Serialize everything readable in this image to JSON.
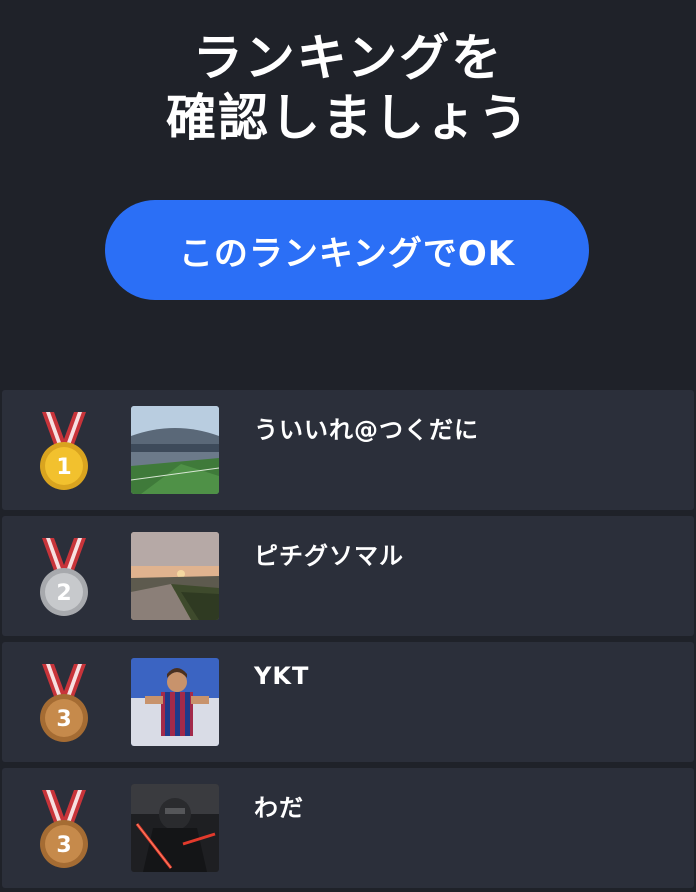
{
  "header": {
    "title_line1": "ランキングを",
    "title_line2": "確認しましょう"
  },
  "confirm_button_label": "このランキングでOK",
  "colors": {
    "background": "#1f2229",
    "row_background": "#2b2f3a",
    "button": "#2b6ff6",
    "gold": "#f2c12e",
    "silver": "#c7c9cc",
    "bronze": "#c68a4b",
    "ribbon_red": "#c8343a"
  },
  "rankings": [
    {
      "rank": "1",
      "medal": "gold-medal-icon",
      "avatar": "stadium-photo",
      "name": "ういいれ@つくだに"
    },
    {
      "rank": "2",
      "medal": "silver-medal-icon",
      "avatar": "sunset-river-photo",
      "name": "ピチグソマル"
    },
    {
      "rank": "3",
      "medal": "bronze-medal-icon",
      "avatar": "soccer-player-photo",
      "name": "YKT"
    },
    {
      "rank": "3",
      "medal": "bronze-medal-icon",
      "avatar": "dark-lightsaber-photo",
      "name": "わだ"
    }
  ]
}
